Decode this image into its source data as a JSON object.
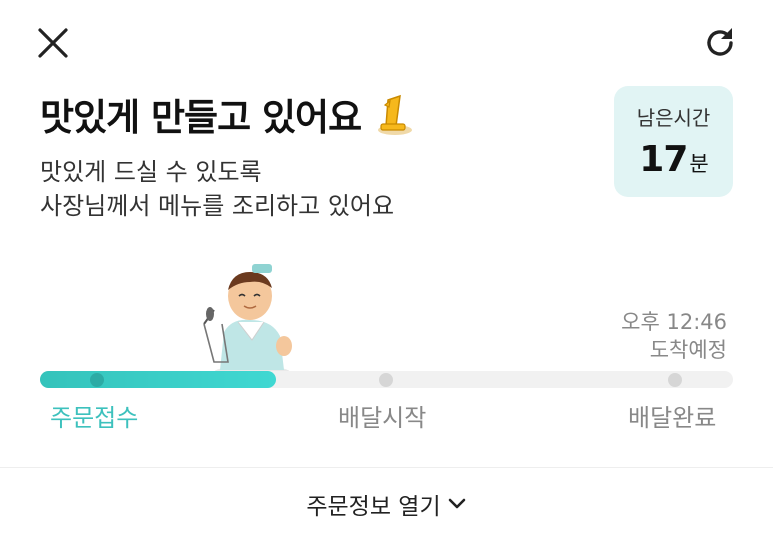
{
  "header": {
    "close_icon": "close-icon",
    "refresh_icon": "refresh-icon"
  },
  "status": {
    "title": "맛있게 만들고 있어요",
    "badge_icon": "number-one-badge-icon",
    "subtitle_line1": "맛있게 드실 수 있도록",
    "subtitle_line2": "사장님께서 메뉴를 조리하고 있어요"
  },
  "remaining": {
    "label": "남은시간",
    "value": "17",
    "unit": "분"
  },
  "arrival": {
    "time": "오후 12:46",
    "label": "도착예정"
  },
  "progress": {
    "fraction": 0.34,
    "steps": [
      {
        "label": "주문접수",
        "active": true
      },
      {
        "label": "배달시작",
        "active": false
      },
      {
        "label": "배달완료",
        "active": false
      }
    ]
  },
  "footer": {
    "label": "주문정보 열기",
    "icon": "chevron-down-icon"
  },
  "colors": {
    "accent": "#3dc1bd",
    "time_box_bg": "#e1f4f4",
    "muted": "#888888"
  }
}
